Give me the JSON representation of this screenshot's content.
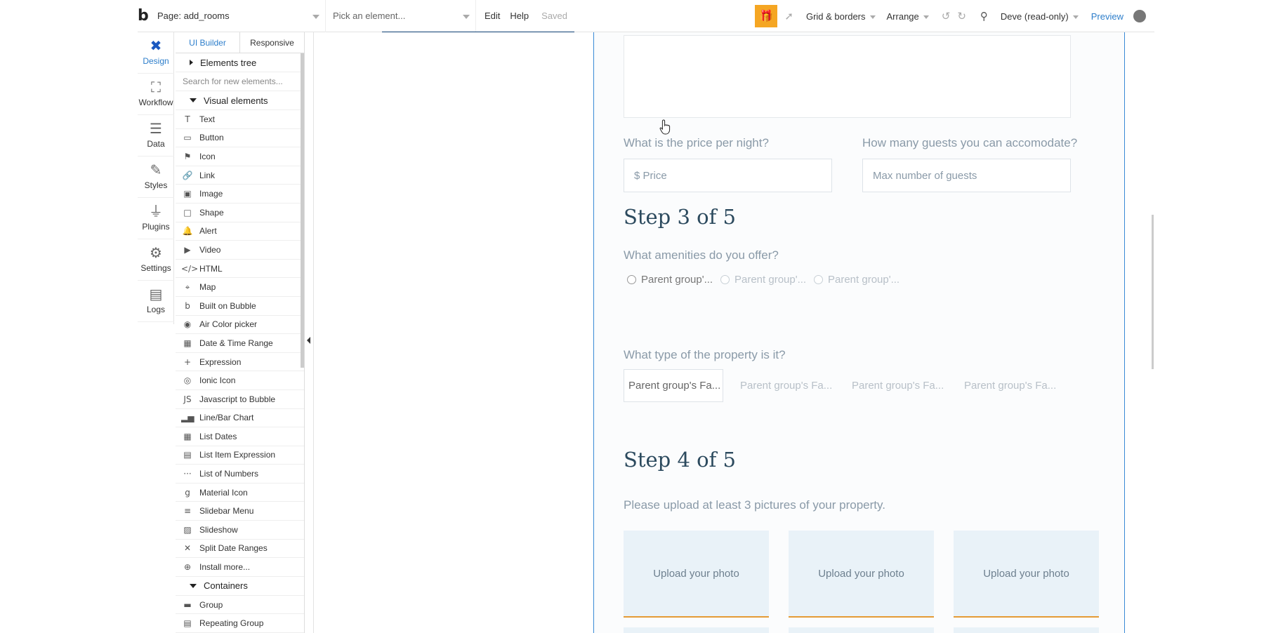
{
  "topbar": {
    "logo": "b",
    "page_selector": "Page: add_rooms",
    "element_picker": "Pick an element...",
    "menu": [
      "Edit",
      "Help"
    ],
    "saved": "Saved",
    "grid_borders": "Grid & borders",
    "arrange": "Arrange",
    "version": "Deve (read-only)",
    "preview": "Preview"
  },
  "rail": [
    {
      "label": "Design",
      "icon": "design-icon"
    },
    {
      "label": "Workflow",
      "icon": "workflow-icon"
    },
    {
      "label": "Data",
      "icon": "database-icon"
    },
    {
      "label": "Styles",
      "icon": "brush-icon"
    },
    {
      "label": "Plugins",
      "icon": "plug-icon"
    },
    {
      "label": "Settings",
      "icon": "gear-icon"
    },
    {
      "label": "Logs",
      "icon": "document-icon"
    }
  ],
  "palette": {
    "tabs": [
      "UI Builder",
      "Responsive"
    ],
    "elements_tree": "Elements tree",
    "search_placeholder": "Search for new elements...",
    "visual_elements": "Visual elements",
    "items": [
      {
        "label": "Text",
        "glyph": "T"
      },
      {
        "label": "Button",
        "glyph": "▭"
      },
      {
        "label": "Icon",
        "glyph": "⚑"
      },
      {
        "label": "Link",
        "glyph": "🔗"
      },
      {
        "label": "Image",
        "glyph": "▣"
      },
      {
        "label": "Shape",
        "glyph": "□"
      },
      {
        "label": "Alert",
        "glyph": "🔔"
      },
      {
        "label": "Video",
        "glyph": "▶"
      },
      {
        "label": "HTML",
        "glyph": "</>"
      },
      {
        "label": "Map",
        "glyph": "⌖"
      },
      {
        "label": "Built on Bubble",
        "glyph": "b"
      },
      {
        "label": "Air Color picker",
        "glyph": "◉"
      },
      {
        "label": "Date & Time Range",
        "glyph": "▦"
      },
      {
        "label": "Expression",
        "glyph": "+"
      },
      {
        "label": "Ionic Icon",
        "glyph": "◎"
      },
      {
        "label": "Javascript to Bubble",
        "glyph": "JS"
      },
      {
        "label": "Line/Bar Chart",
        "glyph": "▂▅"
      },
      {
        "label": "List Dates",
        "glyph": "▦"
      },
      {
        "label": "List Item Expression",
        "glyph": "▤"
      },
      {
        "label": "List of Numbers",
        "glyph": "···"
      },
      {
        "label": "Material Icon",
        "glyph": "g"
      },
      {
        "label": "Slidebar Menu",
        "glyph": "≡"
      },
      {
        "label": "Slideshow",
        "glyph": "▨"
      },
      {
        "label": "Split Date Ranges",
        "glyph": "✕"
      },
      {
        "label": "Install more...",
        "glyph": "⊕"
      }
    ],
    "containers": "Containers",
    "container_items": [
      {
        "label": "Group",
        "glyph": "▬"
      },
      {
        "label": "Repeating Group",
        "glyph": "▤"
      }
    ]
  },
  "form": {
    "price_label": "What is the price per night?",
    "price_placeholder": "$ Price",
    "guests_label": "How many guests you can accomodate?",
    "guests_placeholder": "Max number of guests",
    "step3": "Step 3 of 5",
    "amenities_label": "What amenities do you offer?",
    "amenities_options": [
      "Parent group'...",
      "Parent group'...",
      "Parent group'..."
    ],
    "property_label": "What type of the property is it?",
    "property_options": [
      "Parent group's Fa...",
      "Parent group's Fa...",
      "Parent group's Fa...",
      "Parent group's Fa..."
    ],
    "step4": "Step 4 of 5",
    "upload_label": "Please upload at least 3 pictures of your property.",
    "upload_buttons": [
      "Upload your photo",
      "Upload your photo",
      "Upload your photo"
    ]
  },
  "colors": {
    "accent": "#2d7ecb",
    "upload_border": "#e49b35",
    "gift": "#f5a623"
  }
}
